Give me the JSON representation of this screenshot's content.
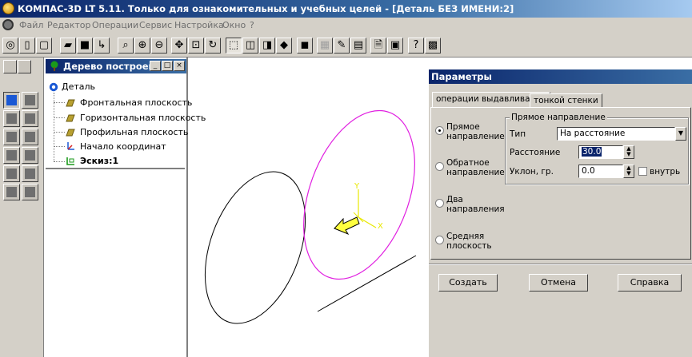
{
  "window": {
    "title": "КОМПАС-3D LT 5.11. Только для ознакомительных и учебных целей - [Деталь БЕЗ ИМЕНИ:2]"
  },
  "menu": {
    "items": [
      "Файл",
      "Редактор",
      "Операции",
      "Сервис",
      "Настройка",
      "Окно",
      "?"
    ]
  },
  "toolbar": {
    "buttons": [
      {
        "icon": "model-icon",
        "glyph": "◎"
      },
      {
        "icon": "new-document-icon",
        "glyph": "▯"
      },
      {
        "icon": "new-file-icon",
        "glyph": "▢"
      },
      {
        "icon": "open-folder-icon",
        "glyph": "▰"
      },
      {
        "icon": "save-icon",
        "glyph": "■"
      },
      {
        "icon": "sketch-icon",
        "glyph": "↳"
      },
      {
        "icon": "zoom-window-icon",
        "glyph": "⌕"
      },
      {
        "icon": "zoom-in-icon",
        "glyph": "⊕"
      },
      {
        "icon": "zoom-out-icon",
        "glyph": "⊖"
      },
      {
        "icon": "pan-icon",
        "glyph": "✥"
      },
      {
        "icon": "zoom-fit-icon",
        "glyph": "⊡"
      },
      {
        "icon": "rotate-icon",
        "glyph": "↻"
      },
      {
        "icon": "wireframe-icon",
        "glyph": "⬚"
      },
      {
        "icon": "hidden-lines-icon",
        "glyph": "◫"
      },
      {
        "icon": "hidden-thin-lines-icon",
        "glyph": "◨"
      },
      {
        "icon": "shaded-icon",
        "glyph": "◆"
      },
      {
        "icon": "shaded-edges-icon",
        "glyph": "◼"
      },
      {
        "icon": "properties-icon",
        "glyph": "▦"
      },
      {
        "icon": "measure-icon",
        "glyph": "✎"
      },
      {
        "icon": "mass-properties-icon",
        "glyph": "▤"
      },
      {
        "icon": "print-preview-icon",
        "glyph": "🗎"
      },
      {
        "icon": "library-icon",
        "glyph": "▣"
      },
      {
        "icon": "help-pointer-icon",
        "glyph": "?"
      },
      {
        "icon": "book-icon",
        "glyph": "▩"
      }
    ]
  },
  "tree": {
    "title": "Дерево построения",
    "root": "Деталь",
    "items": [
      {
        "label": "Фронтальная плоскость",
        "bold": false
      },
      {
        "label": "Горизонтальная плоскость",
        "bold": false
      },
      {
        "label": "Профильная плоскость",
        "bold": false
      },
      {
        "label": "Начало координат",
        "bold": false
      },
      {
        "label": "Эскиз:1",
        "bold": true
      }
    ]
  },
  "canvas": {
    "axis_y": "Y",
    "axis_x": "X"
  },
  "dialog": {
    "title": "Параметры",
    "tabs": [
      "операции выдавливания",
      "тонкой стенки"
    ],
    "directions": [
      {
        "label": "Прямое направление",
        "selected": true
      },
      {
        "label": "Обратное направление",
        "selected": false
      },
      {
        "label": "Два направления",
        "selected": false
      },
      {
        "label": "Средняя плоскость",
        "selected": false
      }
    ],
    "group_title": "Прямое направление",
    "type_label": "Тип",
    "type_value": "На расстояние",
    "distance_label": "Расстояние",
    "distance_value": "30.0",
    "draft_label": "Уклон, гр.",
    "draft_value": "0.0",
    "inside_label": "внутрь",
    "buttons": {
      "create": "Создать",
      "cancel": "Отмена",
      "help": "Справка"
    }
  },
  "colors": {
    "titlebar": "#0a246a",
    "sketch_circle": "#e01ee0",
    "axis": "#e8e800",
    "window_bg": "#d4d0c8"
  }
}
